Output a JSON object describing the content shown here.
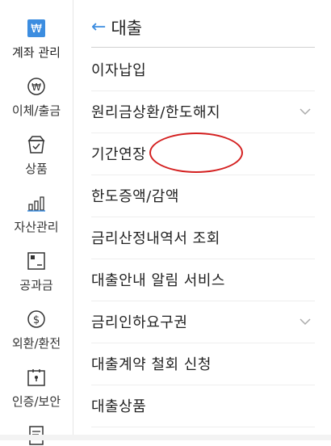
{
  "sidebar": {
    "items": [
      {
        "label": "계좌 관리",
        "icon": "won-card-icon",
        "active": true
      },
      {
        "label": "이체/출금",
        "icon": "won-circle-icon"
      },
      {
        "label": "상품",
        "icon": "shopping-bag-icon"
      },
      {
        "label": "자산관리",
        "icon": "bar-chart-icon"
      },
      {
        "label": "공과금",
        "icon": "bill-icon"
      },
      {
        "label": "외환/환전",
        "icon": "dollar-circle-icon"
      },
      {
        "label": "인증/보안",
        "icon": "lock-box-icon"
      }
    ]
  },
  "header": {
    "title": "대출",
    "back_icon": "back-arrow-icon"
  },
  "menu": {
    "items": [
      {
        "label": "이자납입"
      },
      {
        "label": "원리금상환/한도해지",
        "expandable": true
      },
      {
        "label": "기간연장",
        "highlighted": true
      },
      {
        "label": "한도증액/감액"
      },
      {
        "label": "금리산정내역서 조회"
      },
      {
        "label": "대출안내 알림 서비스"
      },
      {
        "label": "금리인하요구권",
        "expandable": true
      },
      {
        "label": "대출계약 철회 신청"
      },
      {
        "label": "대출상품"
      }
    ]
  },
  "colors": {
    "accent": "#3c8de0",
    "annotation": "#d42020"
  }
}
